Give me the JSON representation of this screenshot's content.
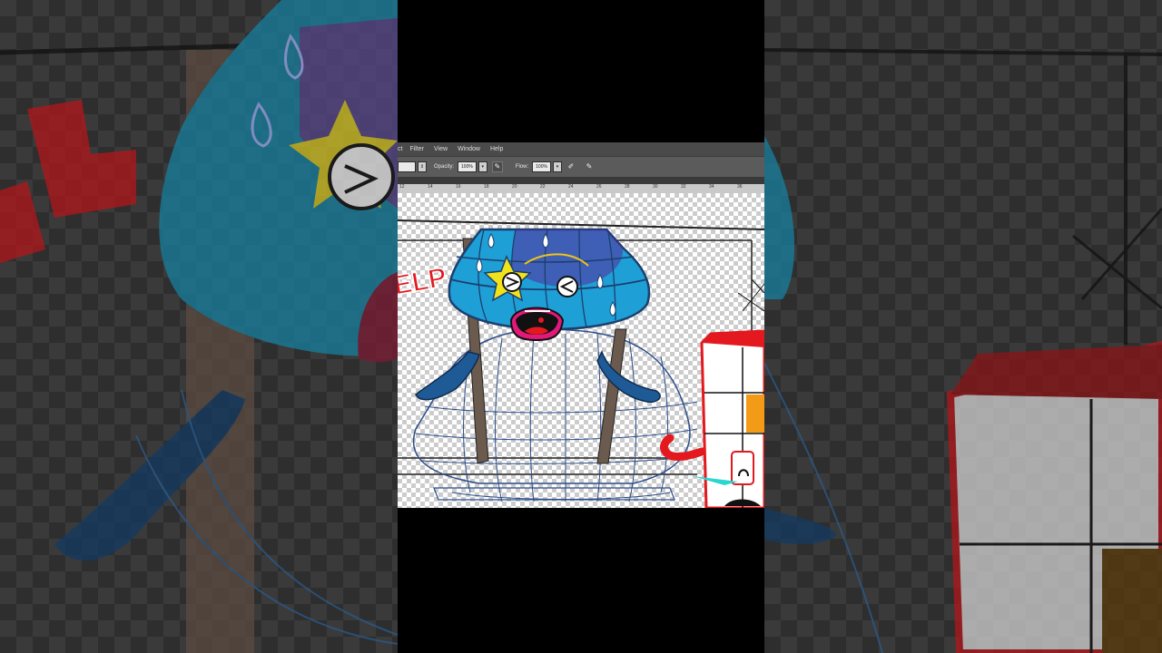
{
  "menu": {
    "items": [
      "ct",
      "Filter",
      "View",
      "Window",
      "Help"
    ]
  },
  "options_bar": {
    "opacity_label": "Opacity:",
    "opacity_value": "100%",
    "flow_label": "Flow:",
    "flow_value": "100%"
  },
  "ruler": {
    "ticks": [
      "12",
      "14",
      "16",
      "18",
      "20",
      "22",
      "24",
      "26",
      "28",
      "30",
      "32",
      "34",
      "36"
    ]
  },
  "artwork": {
    "help_text": "ELP",
    "background_help_text": "ELP"
  },
  "colors": {
    "character_blue": "#1e9fd6",
    "character_dark": "#1b3f6e",
    "star": "#f2e21b",
    "accent_red": "#e3191f",
    "orange": "#f39a16"
  },
  "icons": [
    "brush-pressure-icon",
    "airbrush-icon",
    "tablet-pressure-icon"
  ]
}
